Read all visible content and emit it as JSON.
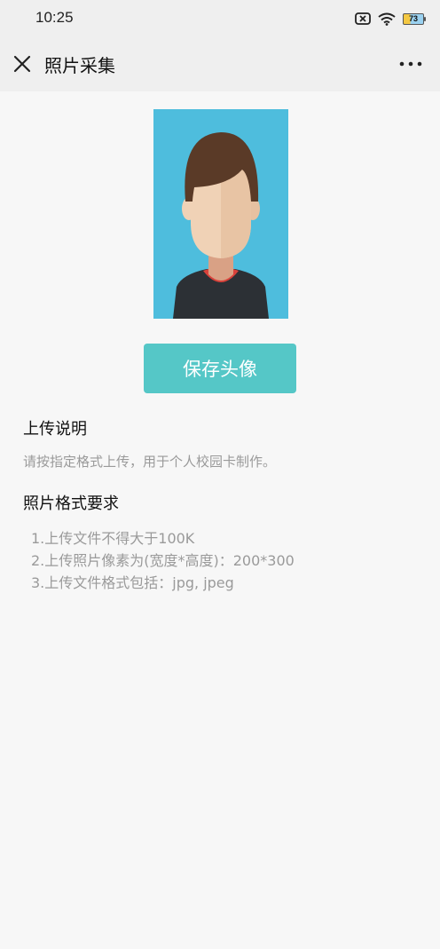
{
  "status_bar": {
    "time": "10:25",
    "battery_level": "73",
    "icons": [
      "sim-off-icon",
      "wifi-icon",
      "battery-icon"
    ]
  },
  "nav": {
    "title": "照片采集",
    "close_icon": "close-icon",
    "more_icon": "more-icon"
  },
  "photo": {
    "icon": "default-avatar-photo",
    "background_color": "#4ebddd"
  },
  "save_button": {
    "label": "保存头像",
    "color": "#55c7c7"
  },
  "upload_section": {
    "title": "上传说明",
    "description": "请按指定格式上传，用于个人校园卡制作。"
  },
  "format_section": {
    "title": "照片格式要求",
    "items": [
      "1.上传文件不得大于100K",
      "2.上传照片像素为(宽度*高度)：200*300",
      "3.上传文件格式包括：jpg, jpeg"
    ]
  }
}
